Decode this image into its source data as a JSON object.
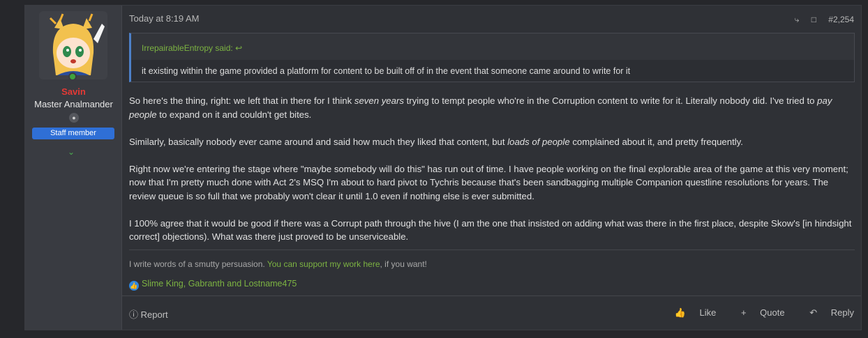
{
  "user": {
    "name": "Savin",
    "title": "Master Analmander",
    "badge": "Staff member"
  },
  "post": {
    "time": "Today at 8:19 AM",
    "number": "#2,254",
    "quote": {
      "author": "IrrepairableEntropy said:",
      "text": "it existing within the game provided a platform for content to be built off of in the event that someone came around to write for it"
    },
    "paragraphs": [
      {
        "p1": "So here's the thing, right: we left that in there for I think ",
        "e1": "seven years",
        "p2": " trying to tempt people who're in the Corruption content to write for it. Literally nobody did. I've tried to ",
        "e2": "pay people",
        "p3": " to expand on it and couldn't get bites."
      },
      {
        "p1": "Similarly, basically nobody ever came around and said how much they liked that content, but ",
        "e1": "loads of people",
        "p2": " complained about it, and pretty frequently."
      },
      {
        "text": "Right now we're entering the stage where \"maybe somebody will do this\" has run out of time. I have people working on the final explorable area of the game at this very moment; now that I'm pretty much done with Act 2's MSQ I'm about to hard pivot to Tychris because that's been sandbagging multiple Companion questline resolutions for years. The review queue is so full that we probably won't clear it until 1.0 even if nothing else is ever submitted."
      },
      {
        "text": "I 100% agree that it would be good if there was a Corrupt path through the hive (I am the one that insisted on adding what was there in the first place, despite Skow's [in hindsight correct] objections). What was there just proved to be unserviceable."
      }
    ],
    "signature": {
      "before": "I write words of a smutty persuasion. ",
      "link": "You can support my work here",
      "after": ", if you want!"
    },
    "reactions": "Slime King, Gabranth and Lostname475",
    "footer": {
      "report": "Report",
      "like": "Like",
      "quote": "Quote",
      "reply": "Reply"
    }
  }
}
